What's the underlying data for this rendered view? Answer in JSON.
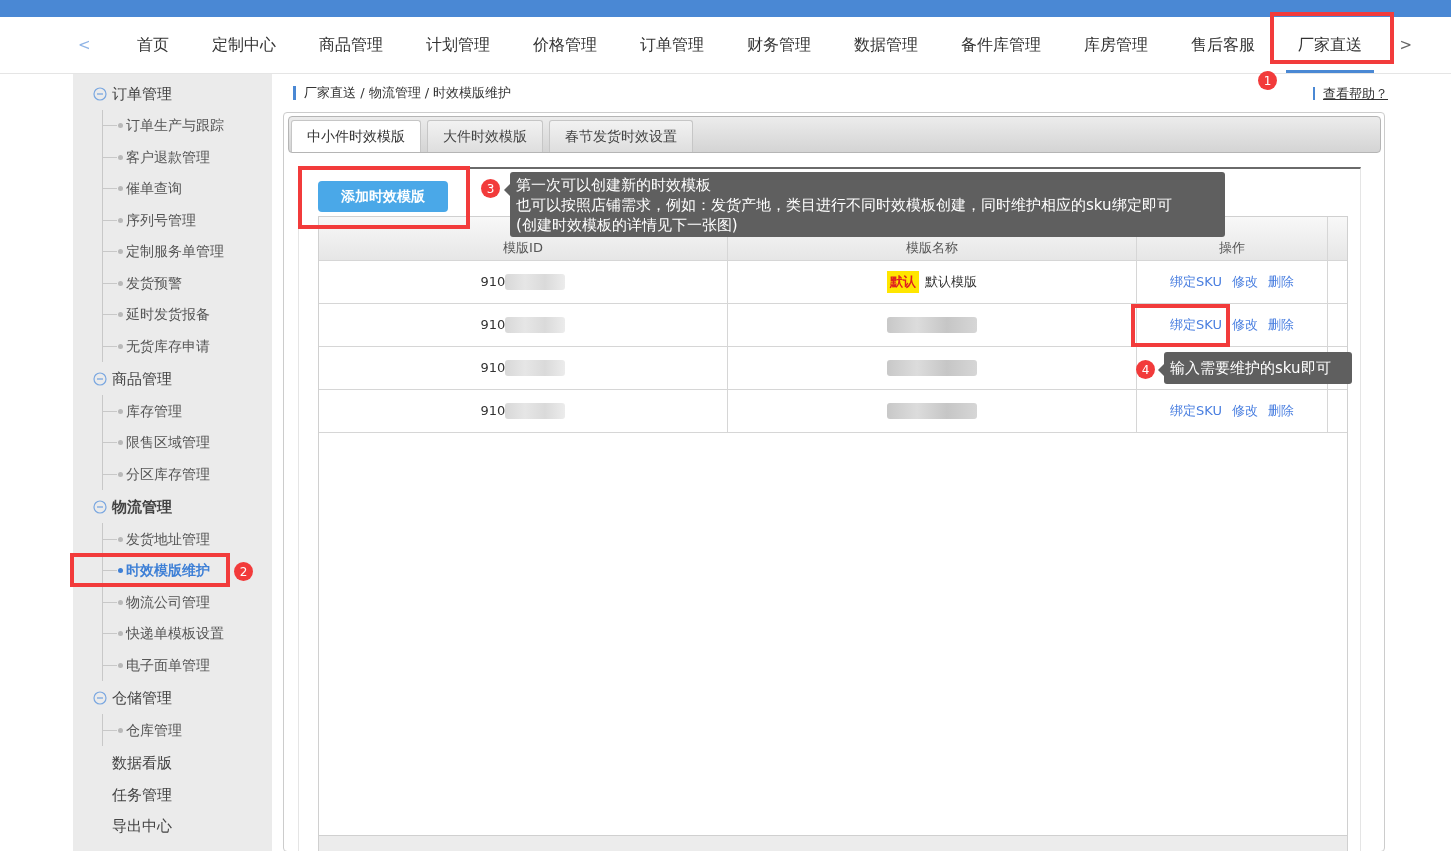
{
  "nav": {
    "prev": "<",
    "next": ">",
    "items": [
      {
        "label": "首页",
        "selected": false
      },
      {
        "label": "定制中心",
        "selected": false
      },
      {
        "label": "商品管理",
        "selected": false
      },
      {
        "label": "计划管理",
        "selected": false
      },
      {
        "label": "价格管理",
        "selected": false
      },
      {
        "label": "订单管理",
        "selected": false
      },
      {
        "label": "财务管理",
        "selected": false
      },
      {
        "label": "数据管理",
        "selected": false
      },
      {
        "label": "备件库管理",
        "selected": false
      },
      {
        "label": "库房管理",
        "selected": false
      },
      {
        "label": "售后客服",
        "selected": false
      },
      {
        "label": "厂家直送",
        "selected": true
      }
    ]
  },
  "sidebar": {
    "groups": [
      {
        "label": "订单管理",
        "expanded": true,
        "selected": false,
        "children": [
          {
            "label": "订单生产与跟踪",
            "selected": false
          },
          {
            "label": "客户退款管理",
            "selected": false
          },
          {
            "label": "催单查询",
            "selected": false
          },
          {
            "label": "序列号管理",
            "selected": false
          },
          {
            "label": "定制服务单管理",
            "selected": false
          },
          {
            "label": "发货预警",
            "selected": false
          },
          {
            "label": "延时发货报备",
            "selected": false
          },
          {
            "label": "无货库存申请",
            "selected": false
          }
        ]
      },
      {
        "label": "商品管理",
        "expanded": true,
        "selected": false,
        "children": [
          {
            "label": "库存管理",
            "selected": false
          },
          {
            "label": "限售区域管理",
            "selected": false
          },
          {
            "label": "分区库存管理",
            "selected": false
          }
        ]
      },
      {
        "label": "物流管理",
        "expanded": true,
        "selected": true,
        "children": [
          {
            "label": "发货地址管理",
            "selected": false
          },
          {
            "label": "时效模版维护",
            "selected": true
          },
          {
            "label": "物流公司管理",
            "selected": false
          },
          {
            "label": "快递单模板设置",
            "selected": false
          },
          {
            "label": "电子面单管理",
            "selected": false
          }
        ]
      },
      {
        "label": "仓储管理",
        "expanded": true,
        "selected": false,
        "children": [
          {
            "label": "仓库管理",
            "selected": false
          }
        ]
      }
    ],
    "links": [
      "数据看版",
      "任务管理",
      "导出中心"
    ]
  },
  "breadcrumb": "厂家直送 / 物流管理 / 时效模版维护",
  "help": "查看帮助？",
  "tabs": [
    {
      "label": "中小件时效模版",
      "selected": true
    },
    {
      "label": "大件时效模版",
      "selected": false
    },
    {
      "label": "春节发货时效设置",
      "selected": false
    }
  ],
  "add_button": "添加时效模版",
  "table": {
    "columns": [
      "模版ID",
      "模版名称",
      "操作"
    ],
    "rows": [
      {
        "id": "910",
        "id_redacted": true,
        "tag": "默认",
        "name": "默认模版",
        "actions": [
          "绑定SKU",
          "修改",
          "删除"
        ]
      },
      {
        "id": "910",
        "id_redacted": true,
        "name_redacted": true,
        "actions": [
          "绑定SKU",
          "修改",
          "删除"
        ]
      },
      {
        "id": "910",
        "id_redacted": true,
        "name_redacted": true,
        "actions": []
      },
      {
        "id": "910",
        "id_redacted": true,
        "name_redacted": true,
        "actions": [
          "绑定SKU",
          "修改",
          "删除"
        ]
      }
    ]
  },
  "annotations": [
    {
      "number": "1",
      "boxed": true
    },
    {
      "number": "2",
      "boxed": true
    },
    {
      "number": "3",
      "boxed": true,
      "lines": [
        "第一次可以创建新的时效模板",
        "也可以按照店铺需求，例如：发货产地，类目进行不同时效模板创建，同时维护相应的sku绑定即可",
        "(创建时效模板的详情见下一张图)"
      ]
    },
    {
      "number": "4",
      "boxed": true,
      "lines": [
        "输入需要维护的sku即可"
      ]
    }
  ]
}
